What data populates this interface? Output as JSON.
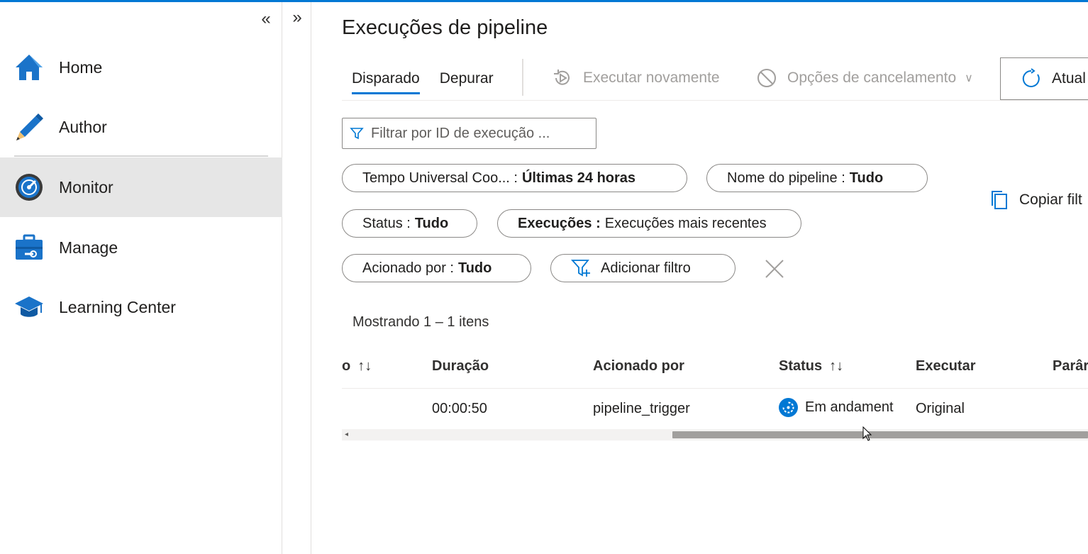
{
  "sidebar": {
    "collapse_glyph": "«",
    "items": [
      {
        "label": "Home",
        "icon": "home-icon"
      },
      {
        "label": "Author",
        "icon": "pencil-icon"
      },
      {
        "label": "Monitor",
        "icon": "monitor-gauge-icon",
        "active": true
      },
      {
        "label": "Manage",
        "icon": "toolbox-icon"
      },
      {
        "label": "Learning Center",
        "icon": "graduation-cap-icon"
      }
    ]
  },
  "strip": {
    "expand_glyph": "»"
  },
  "main": {
    "title": "Execuções de pipeline",
    "tabs": [
      {
        "label": "Disparado",
        "active": true
      },
      {
        "label": "Depurar"
      }
    ],
    "toolbar": {
      "rerun_label": "Executar novamente",
      "cancel_label": "Opções de cancelamento",
      "refresh_label": "Atual"
    },
    "filter": {
      "placeholder": "Filtrar por ID de execução ..."
    },
    "pills": {
      "time": {
        "key": "Tempo Universal Coo... :",
        "value": "Últimas 24 horas"
      },
      "pipeline": {
        "key": "Nome do pipeline :",
        "value": "Tudo"
      },
      "status": {
        "key": "Status :",
        "value": "Tudo"
      },
      "runs": {
        "key": "Execuções :",
        "value": "Execuções mais recentes"
      },
      "triggered": {
        "key": "Acionado por :",
        "value": "Tudo"
      },
      "add_filter": "Adicionar filtro"
    },
    "copy_filters_label": "Copiar filt",
    "showing": "Mostrando 1 – 1 itens",
    "table": {
      "columns": [
        "o",
        "Duração",
        "Acionado por",
        "Status",
        "Executar",
        "Parâr"
      ],
      "sort_glyph": "↑↓",
      "rows": [
        {
          "duration": "00:00:50",
          "triggered_by": "pipeline_trigger",
          "status": "Em andament",
          "run": "Original"
        }
      ]
    }
  },
  "colors": {
    "accent": "#0078d4",
    "disabled_text": "#a19f9d",
    "active_nav_bg": "#e6e6e6"
  }
}
